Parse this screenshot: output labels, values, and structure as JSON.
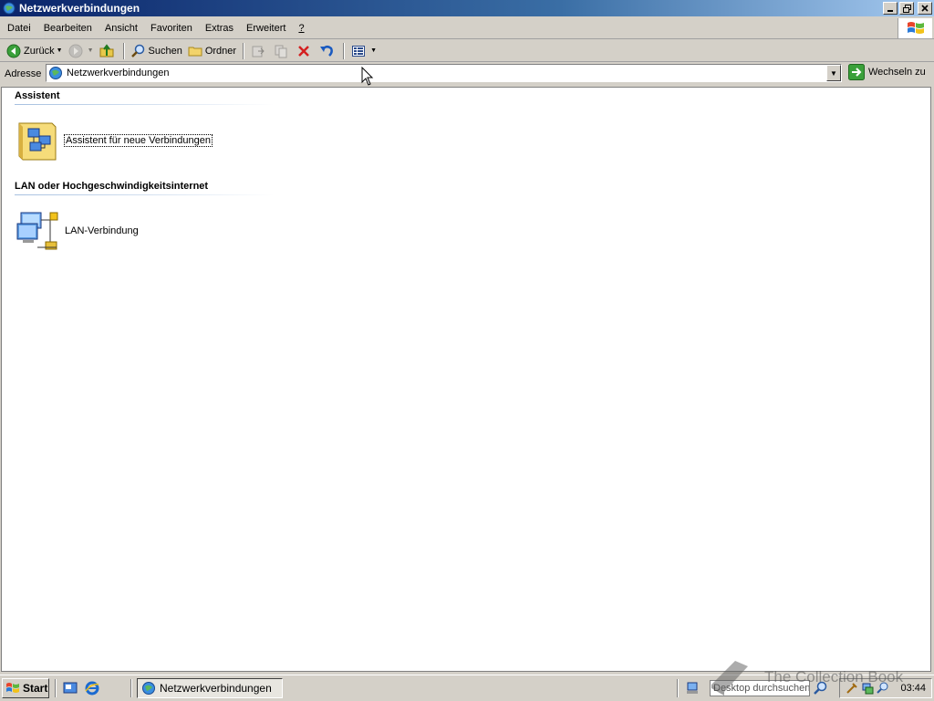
{
  "window": {
    "title": "Netzwerkverbindungen"
  },
  "menu": [
    {
      "label": "Datei",
      "name": "menu-datei"
    },
    {
      "label": "Bearbeiten",
      "name": "menu-bearbeiten"
    },
    {
      "label": "Ansicht",
      "name": "menu-ansicht"
    },
    {
      "label": "Favoriten",
      "name": "menu-favoriten"
    },
    {
      "label": "Extras",
      "name": "menu-extras"
    },
    {
      "label": "Erweitert",
      "name": "menu-erweitert"
    },
    {
      "label": "?",
      "name": "menu-help"
    }
  ],
  "toolbar": {
    "back_label": "Zurück",
    "search_label": "Suchen",
    "folders_label": "Ordner"
  },
  "address": {
    "label": "Adresse",
    "value": "Netzwerkverbindungen",
    "go_label": "Wechseln zu"
  },
  "groups": [
    {
      "header": "Assistent",
      "items": [
        {
          "label": "Assistent für neue Verbindungen",
          "icon": "wizard-icon"
        }
      ]
    },
    {
      "header": "LAN oder Hochgeschwindigkeitsinternet",
      "items": [
        {
          "label": "LAN-Verbindung",
          "icon": "lan-connection-icon"
        }
      ]
    }
  ],
  "taskbar": {
    "start_label": "Start",
    "task_label": "Netzwerkverbindungen",
    "search_placeholder": "Desktop durchsuchen",
    "clock": "03:44"
  },
  "watermark": "The Collection Book",
  "colors": {
    "titlebar_start": "#0a246a",
    "titlebar_end": "#a6caf0",
    "chrome": "#d4d0c8",
    "content_bg": "#ffffff"
  }
}
